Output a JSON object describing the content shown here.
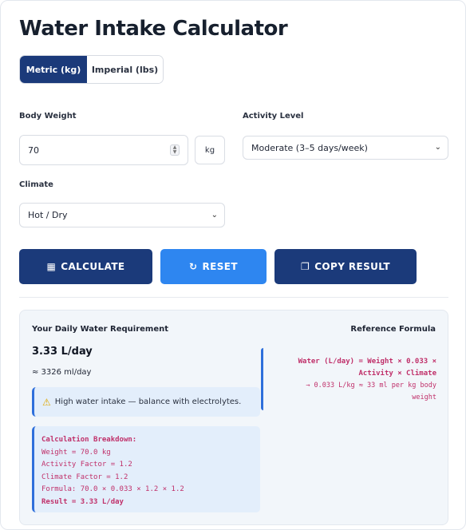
{
  "title": "Water Intake Calculator",
  "units": {
    "metric_label": "Metric (kg)",
    "imperial_label": "Imperial (lbs)",
    "selected": "metric"
  },
  "form": {
    "weight_label": "Body Weight",
    "weight_value": "70",
    "weight_unit": "kg",
    "activity_label": "Activity Level",
    "activity_value": "Moderate (3–5 days/week)",
    "climate_label": "Climate",
    "climate_value": "Hot / Dry"
  },
  "buttons": {
    "calculate": "CALCULATE",
    "reset": "RESET",
    "copy": "COPY RESULT"
  },
  "result": {
    "heading": "Your Daily Water Requirement",
    "liters": "3.33 L/day",
    "ml": "≈ 3326 ml/day",
    "alert": "High water intake — balance with electrolytes.",
    "breakdown": {
      "title": "Calculation Breakdown:",
      "weight": "Weight = 70.0 kg",
      "activity": "Activity Factor = 1.2",
      "climate": "Climate Factor = 1.2",
      "formula": "Formula: 70.0 × 0.033 × 1.2 × 1.2",
      "result": "Result = 3.33 L/day"
    }
  },
  "reference": {
    "heading": "Reference Formula",
    "line1": "Water (L/day) = Weight × 0.033 ×",
    "line2": "Activity × Climate",
    "line3": "→ 0.033 L/kg ≈ 33 ml per kg body",
    "line4": "weight"
  },
  "colors": {
    "primary": "#1b3a7a",
    "accent": "#2e86f0",
    "code": "#c0306a",
    "panel": "#f2f6fa"
  },
  "icons": {
    "calculate": "calculator-icon",
    "reset": "refresh-icon",
    "copy": "copy-icon",
    "alert": "warning-icon"
  }
}
